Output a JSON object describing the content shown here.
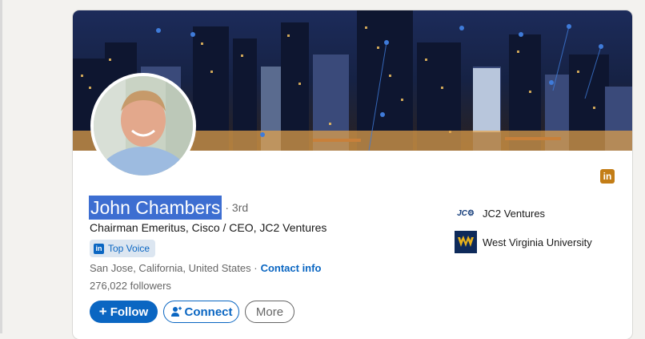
{
  "profile": {
    "name": "John Chambers",
    "degree": "· 3rd",
    "headline": "Chairman Emeritus, Cisco / CEO, JC2 Ventures",
    "badge": "Top Voice",
    "location": "San Jose, California, United States ·",
    "contact_label": "Contact info",
    "followers": "276,022 followers"
  },
  "actions": {
    "follow_label": "Follow",
    "connect_label": "Connect",
    "more_label": "More"
  },
  "organizations": [
    {
      "name": "JC2 Ventures",
      "logo_text": "JC"
    },
    {
      "name": "West Virginia University",
      "logo_text": "WV"
    }
  ],
  "icons": {
    "premium": "linkedin-premium-icon",
    "follow": "plus-icon",
    "connect": "add-person-icon"
  },
  "colors": {
    "brand_blue": "#0a66c2",
    "premium_gold": "#c37d16",
    "selection": "#3d6ed1"
  }
}
